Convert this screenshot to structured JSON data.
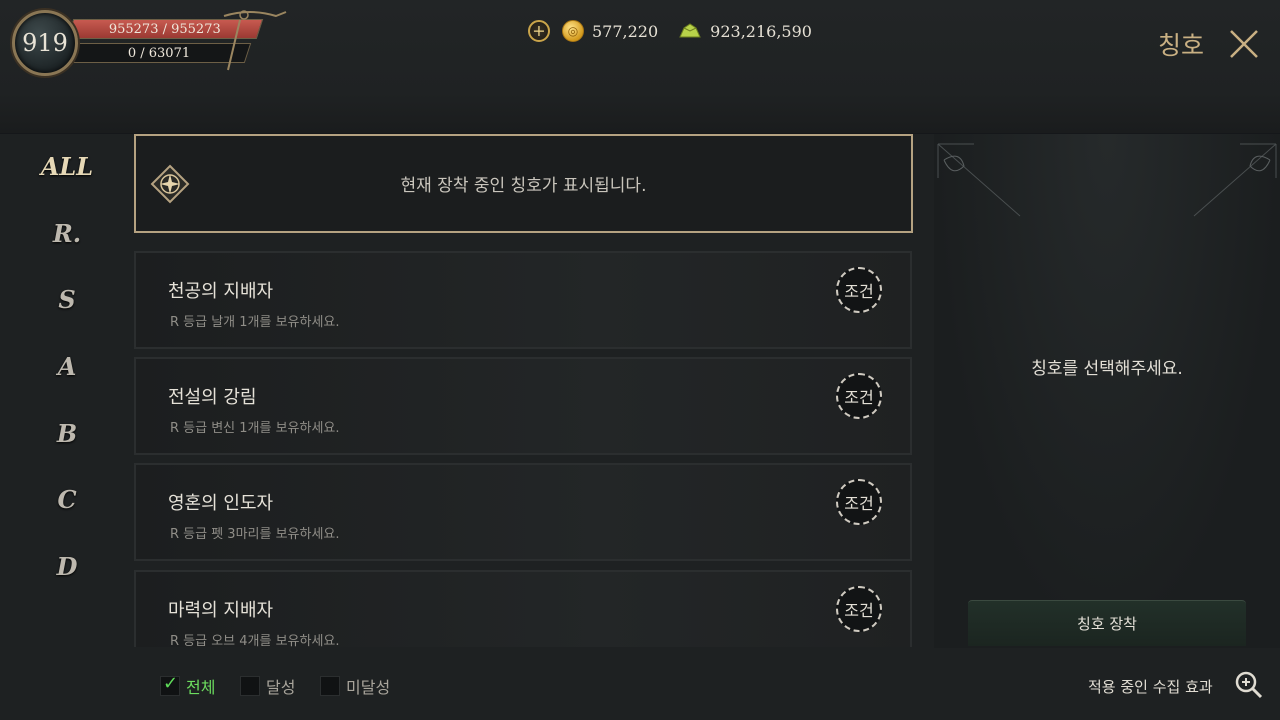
{
  "player": {
    "level": "919",
    "hp_text": "955273 / 955273",
    "exp_text": "0 / 63071"
  },
  "currency": {
    "gold": "577,220",
    "silver": "923,216,590"
  },
  "header": {
    "title": "칭호"
  },
  "grades": [
    "ALL",
    "R.",
    "S",
    "A",
    "B",
    "C",
    "D"
  ],
  "equipped": {
    "placeholder": "현재 장착 중인 칭호가 표시됩니다."
  },
  "titles": [
    {
      "name": "천공의 지배자",
      "condition": "R 등급 날개 1개를 보유하세요.",
      "button": "조건"
    },
    {
      "name": "전설의 강림",
      "condition": "R 등급 변신 1개를 보유하세요.",
      "button": "조건"
    },
    {
      "name": "영혼의 인도자",
      "condition": "R 등급 펫 3마리를 보유하세요.",
      "button": "조건"
    },
    {
      "name": "마력의 지배자",
      "condition": "R 등급 오브 4개를 보유하세요.",
      "button": "조건"
    }
  ],
  "detail": {
    "prompt": "칭호를 선택해주세요.",
    "equip_button": "칭호 장착"
  },
  "filters": {
    "all": "전체",
    "achieved": "달성",
    "unachieved": "미달성"
  },
  "collection_link": "적용 중인 수집 효과"
}
